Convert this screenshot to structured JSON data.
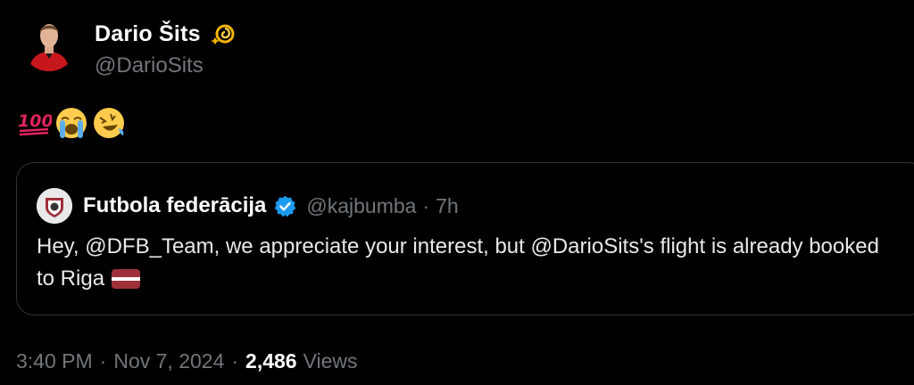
{
  "author": {
    "display_name": "Dario Šits",
    "handle": "@DarioSits",
    "name_emoji": "dizzy-icon"
  },
  "tweet": {
    "emojis": [
      "hundred-points-icon",
      "loudly-crying-face-icon",
      "rolling-on-floor-laughing-icon"
    ]
  },
  "quote": {
    "name": "Futbola federācija",
    "verified": true,
    "handle": "@kajbumba",
    "separator": "·",
    "time": "7h",
    "text": "Hey, @DFB_Team, we appreciate your interest, but @DarioSits's flight is already booked to Riga",
    "flag": "latvia-flag-icon"
  },
  "meta": {
    "time": "3:40 PM",
    "sep1": "·",
    "date": "Nov 7, 2024",
    "sep2": "·",
    "views_count": "2,486",
    "views_label": "Views"
  },
  "colors": {
    "background": "#000000",
    "text_primary": "#e7e9ea",
    "text_secondary": "#71767b",
    "border": "#2f3336",
    "verified_blue": "#1d9bf0"
  }
}
